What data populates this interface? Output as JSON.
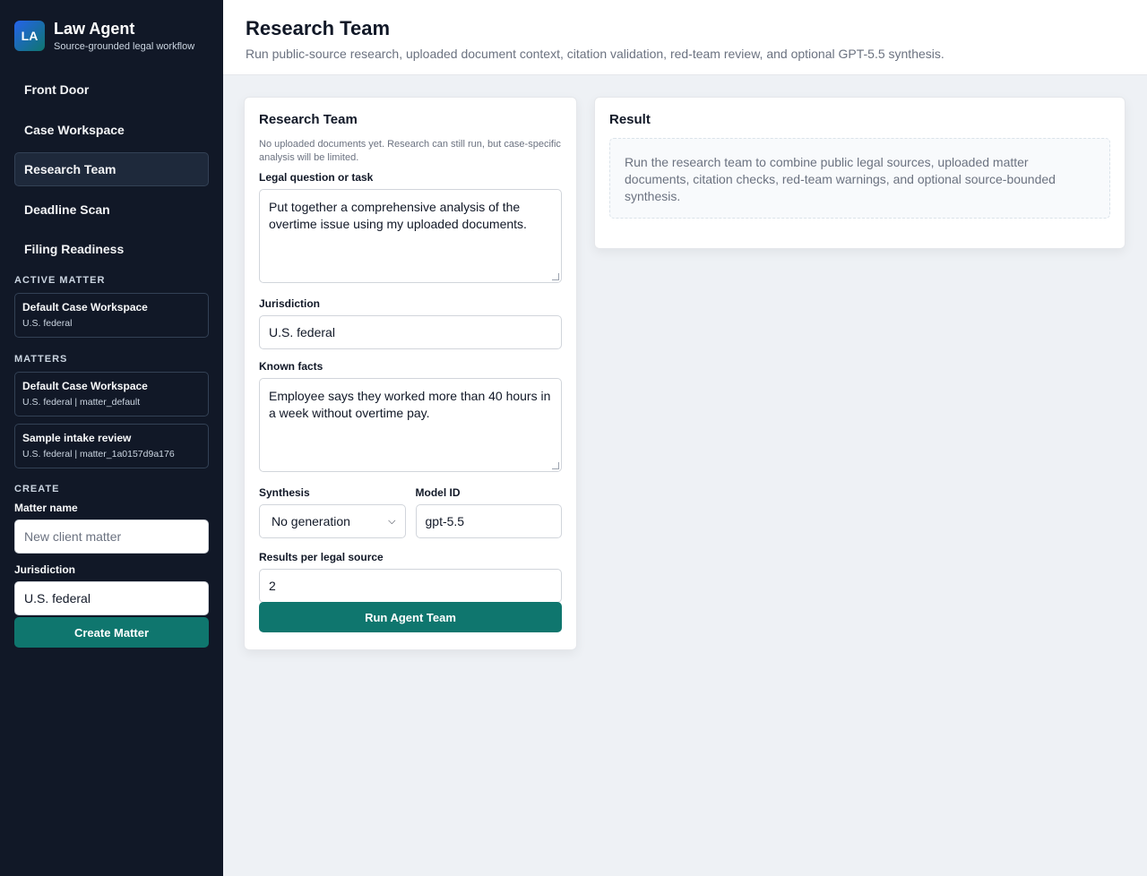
{
  "brand": {
    "logo": "LA",
    "title": "Law Agent",
    "subtitle": "Source-grounded legal workflow"
  },
  "nav": [
    {
      "label": "Front Door",
      "active": false
    },
    {
      "label": "Case Workspace",
      "active": false
    },
    {
      "label": "Research Team",
      "active": true
    },
    {
      "label": "Deadline Scan",
      "active": false
    },
    {
      "label": "Filing Readiness",
      "active": false
    }
  ],
  "active_matter": {
    "section_label": "ACTIVE MATTER",
    "name": "Default Case Workspace",
    "meta": "U.S. federal"
  },
  "matters": {
    "section_label": "MATTERS",
    "items": [
      {
        "name": "Default Case Workspace",
        "meta": "U.S. federal | matter_default"
      },
      {
        "name": "Sample intake review",
        "meta": "U.S. federal | matter_1a0157d9a176"
      }
    ]
  },
  "create": {
    "section_label": "CREATE",
    "matter_name_label": "Matter name",
    "matter_name_placeholder": "New client matter",
    "jurisdiction_label": "Jurisdiction",
    "jurisdiction_value": "U.S. federal",
    "button": "Create Matter"
  },
  "header": {
    "title": "Research Team",
    "subtitle": "Run public-source research, uploaded document context, citation validation, red-team review, and optional GPT-5.5 synthesis."
  },
  "form": {
    "title": "Research Team",
    "note": "No uploaded documents yet. Research can still run, but case-specific analysis will be limited.",
    "question_label": "Legal question or task",
    "question_value": "Put together a comprehensive analysis of the overtime issue using my uploaded documents.",
    "jurisdiction_label": "Jurisdiction",
    "jurisdiction_value": "U.S. federal",
    "facts_label": "Known facts",
    "facts_value": "Employee says they worked more than 40 hours in a week without overtime pay.",
    "synthesis_label": "Synthesis",
    "synthesis_value": "No generation",
    "model_label": "Model ID",
    "model_value": "gpt-5.5",
    "results_label": "Results per legal source",
    "results_value": "2",
    "run_button": "Run Agent Team"
  },
  "result": {
    "title": "Result",
    "placeholder": "Run the research team to combine public legal sources, uploaded matter documents, citation checks, red-team warnings, and optional source-bounded synthesis."
  },
  "colors": {
    "sidebar": "#111827",
    "accent": "#0f766e",
    "background": "#eef1f5"
  }
}
